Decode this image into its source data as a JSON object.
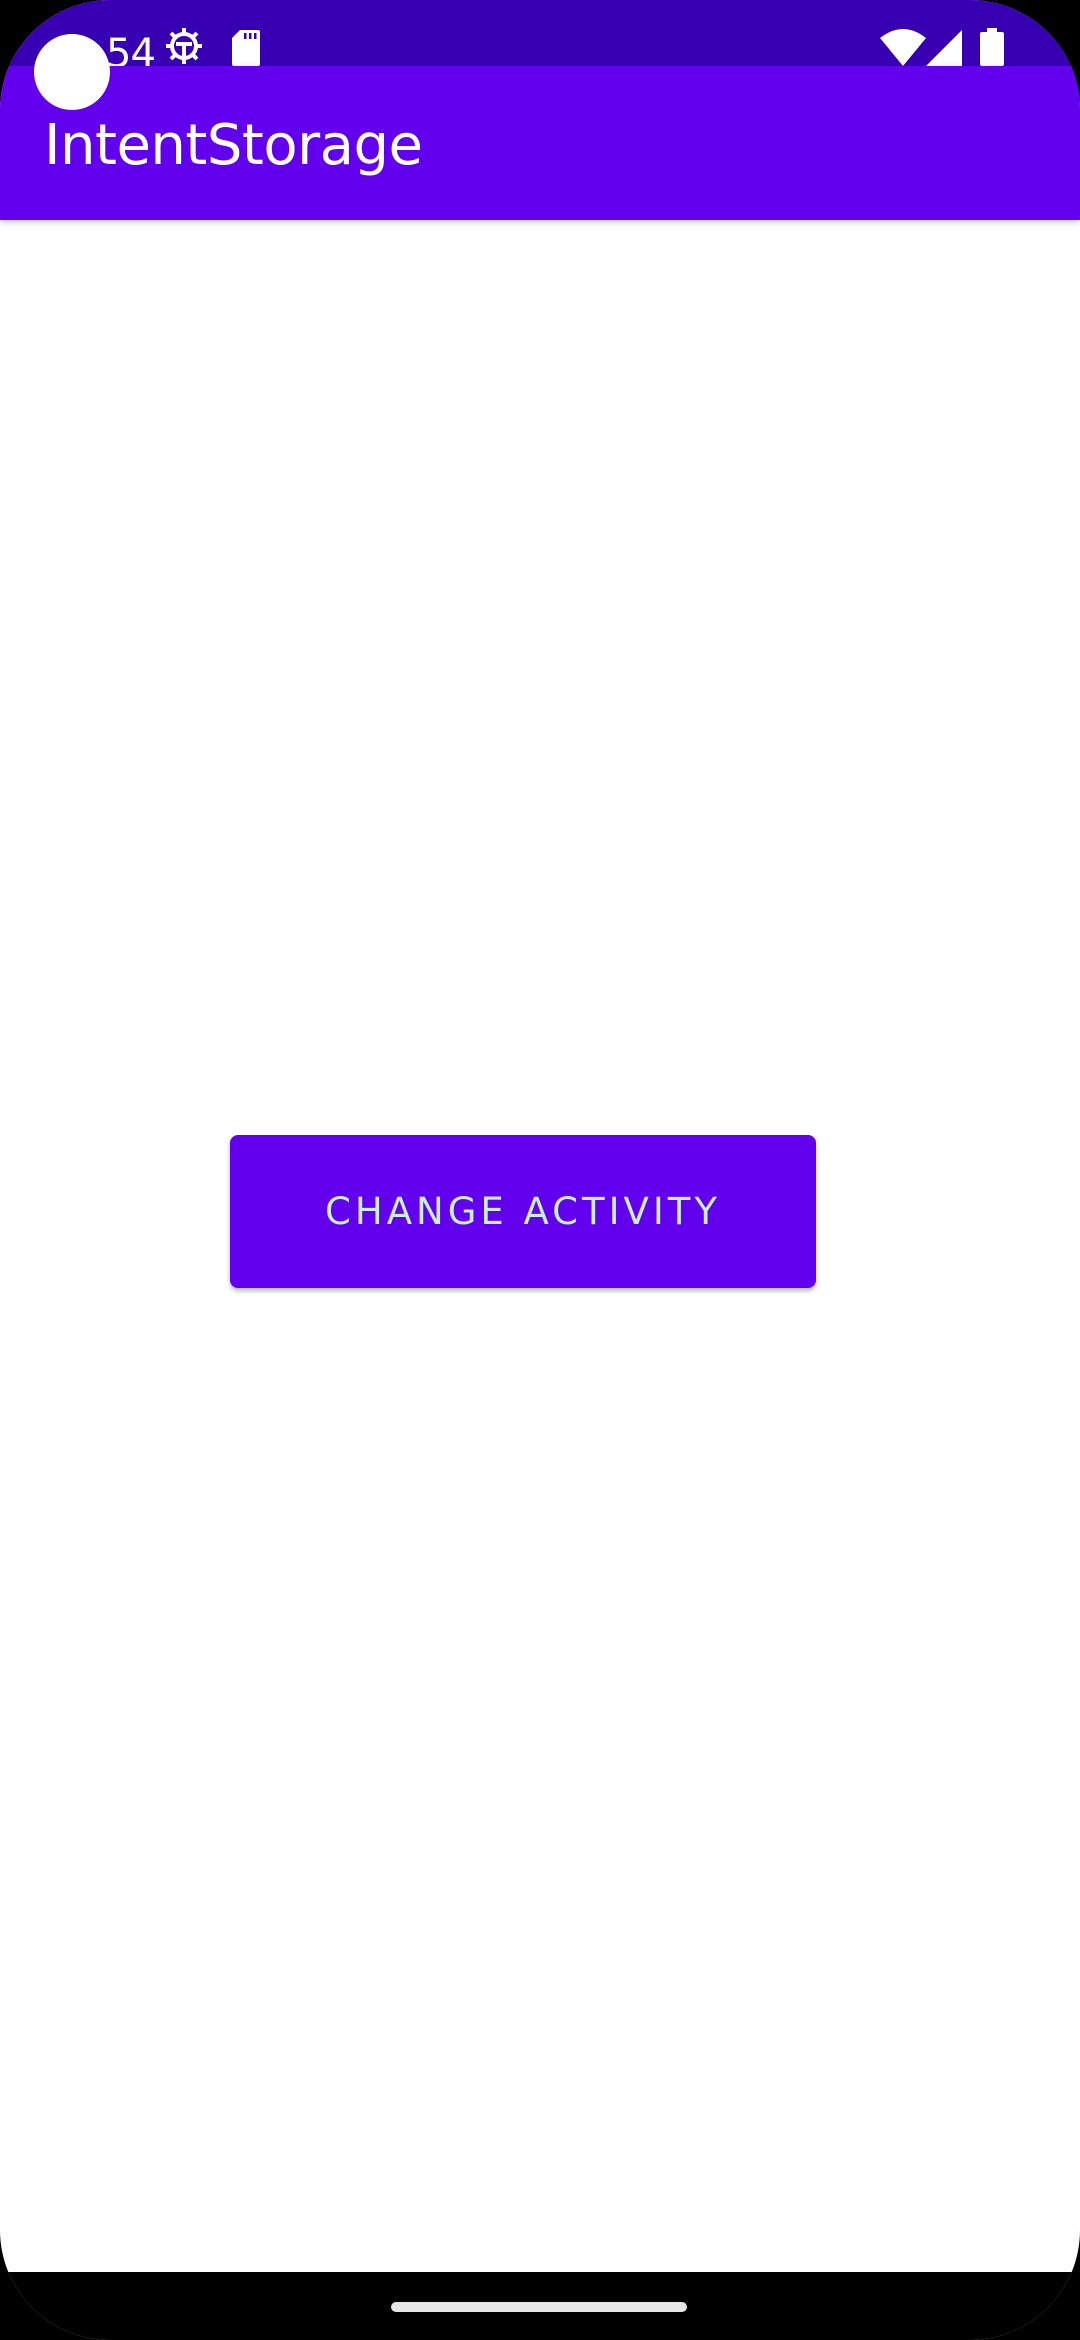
{
  "status_bar": {
    "time": "54",
    "icons": [
      "gear-icon",
      "sd-card-icon",
      "wifi-icon",
      "signal-icon",
      "battery-icon"
    ]
  },
  "app_bar": {
    "title": "IntentStorage"
  },
  "main": {
    "button_label": "CHANGE ACTIVITY"
  },
  "colors": {
    "primary": "#6200ee",
    "primary_dark": "#3700b3",
    "button_text": "#c8f0d8",
    "background": "#ffffff"
  }
}
